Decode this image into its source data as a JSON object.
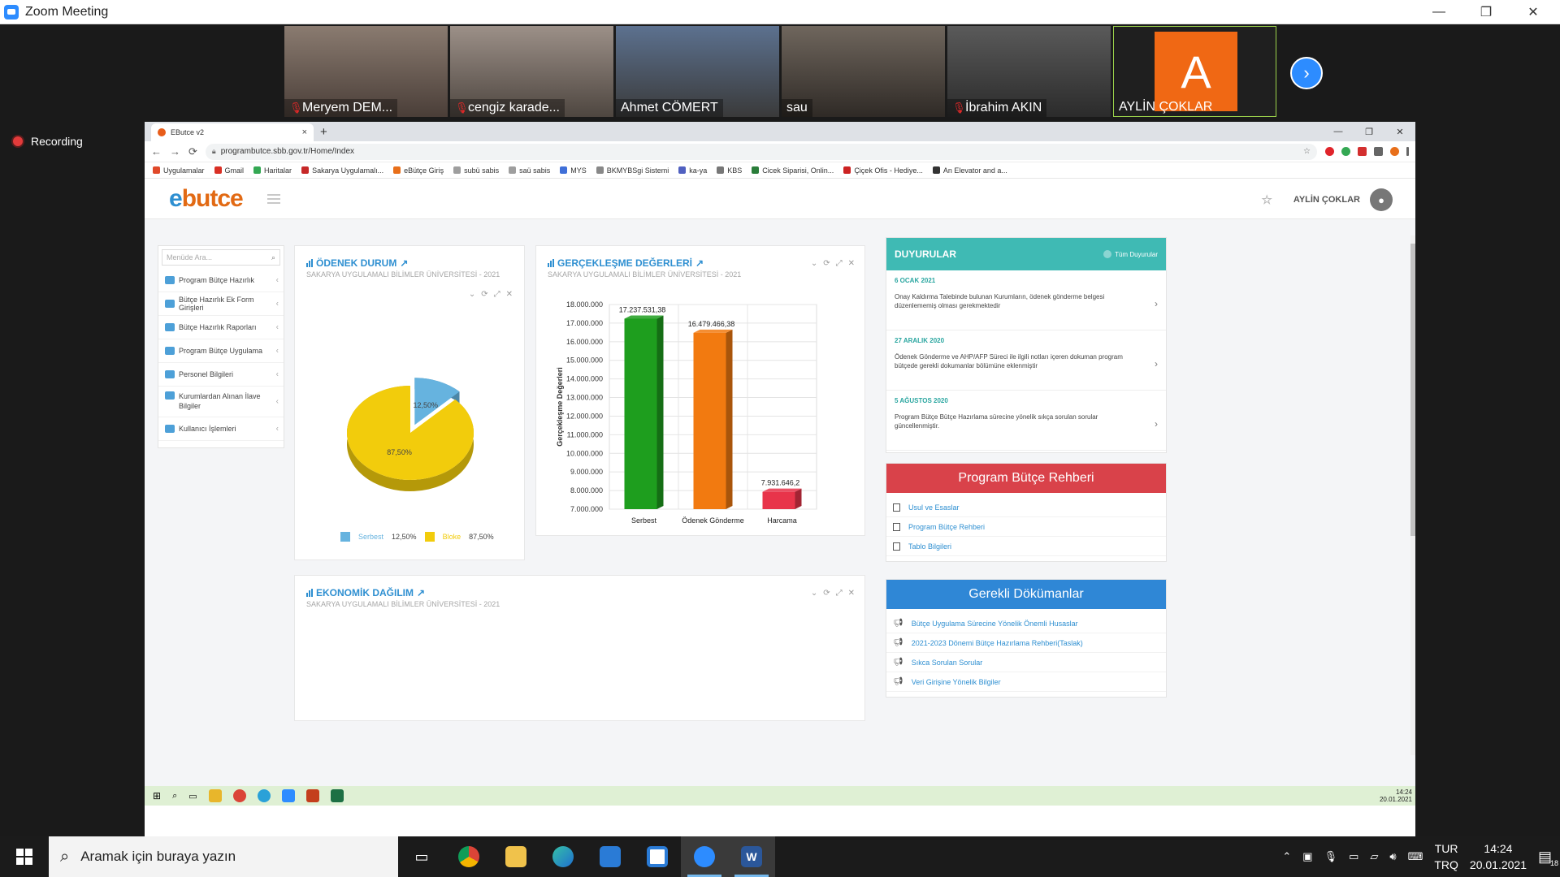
{
  "window": {
    "title": "Zoom Meeting",
    "minimize": "—",
    "restore": "❐",
    "close": "✕"
  },
  "participants": [
    {
      "name": "Meryem DEM...",
      "muted": true,
      "bg": "#6a5a52"
    },
    {
      "name": "cengiz karade...",
      "muted": true,
      "bg": "#7a7068"
    },
    {
      "name": "Ahmet CÖMERT",
      "muted": false,
      "bg": "#4c5f7a"
    },
    {
      "name": "sau",
      "muted": false,
      "bg": "#5a5148"
    },
    {
      "name": "İbrahim AKIN",
      "muted": true,
      "bg": "#4a4a4a"
    }
  ],
  "avatar_tile": {
    "letter": "A",
    "name": "AYLİN ÇOKLAR"
  },
  "next_icon": "›",
  "recording": {
    "label": "Recording"
  },
  "browser": {
    "tab_title": "EButce v2",
    "tab_close": "×",
    "new_tab": "+",
    "url": "programbutce.sbb.gov.tr/Home/Index",
    "nav": {
      "back": "←",
      "forward": "→",
      "reload": "⟳"
    },
    "win": {
      "min": "—",
      "max": "❐",
      "close": "✕"
    },
    "bookmarks": [
      {
        "label": "Uygulamalar",
        "color": "#e0492a"
      },
      {
        "label": "Gmail",
        "color": "#d93025"
      },
      {
        "label": "Haritalar",
        "color": "#34a853"
      },
      {
        "label": "Sakarya Uygulamalı...",
        "color": "#c62828"
      },
      {
        "label": "eBütçe Giriş",
        "color": "#e86f1a"
      },
      {
        "label": "subü sabis",
        "color": "#9e9e9e"
      },
      {
        "label": "saü sabis",
        "color": "#9e9e9e"
      },
      {
        "label": "MYS",
        "color": "#3f6fd8"
      },
      {
        "label": "BKMYBSgi Sistemi",
        "color": "#888888"
      },
      {
        "label": "ka-ya",
        "color": "#5060c0"
      },
      {
        "label": "KBS",
        "color": "#777777"
      },
      {
        "label": "Cicek Siparisi, Onlin...",
        "color": "#2a7d3a"
      },
      {
        "label": "Çiçek Ofis - Hediye...",
        "color": "#cc2222"
      },
      {
        "label": "An Elevator and a...",
        "color": "#333333"
      }
    ]
  },
  "app": {
    "brand_e": "e",
    "brand_rest": "butce",
    "user_name": "AYLİN ÇOKLAR",
    "search_placeholder": "Menüde Ara...",
    "menu": [
      "Program Bütçe Hazırlık",
      "Bütçe Hazırlık Ek Form Girişleri",
      "Bütçe Hazırlık Raporları",
      "Program Bütçe Uygulama",
      "Personel Bilgileri",
      "Kurumlardan Alınan İlave Bilgiler",
      "Kullanıcı İşlemleri"
    ]
  },
  "panel_odenek": {
    "title": "ÖDENEK DURUM",
    "subtitle": "SAKARYA UYGULAMALI BİLİMLER ÜNİVERSİTESİ - 2021"
  },
  "panel_gerceklesme": {
    "title": "GERÇEKLEŞME DEĞERLERİ",
    "subtitle": "SAKARYA UYGULAMALI BİLİMLER ÜNİVERSİTESİ - 2021"
  },
  "panel_ekonomik": {
    "title": "EKONOMİK DAĞILIM",
    "subtitle": "SAKARYA UYGULAMALI BİLİMLER ÜNİVERSİTESİ - 2021"
  },
  "chart_data": [
    {
      "type": "pie",
      "categories": [
        "Serbest",
        "Bloke"
      ],
      "values": [
        12.5,
        87.5
      ],
      "labels": [
        "12,50%",
        "87,50%"
      ],
      "legend_values": [
        "12,50%",
        "87,50%"
      ],
      "colors": [
        "#66b3df",
        "#f2cc0c"
      ],
      "legend": "bottom"
    },
    {
      "type": "bar",
      "categories": [
        "Serbest",
        "Ödenek Gönderme",
        "Harcama"
      ],
      "values": [
        17237531.38,
        16479466.38,
        7931646.2
      ],
      "value_labels": [
        "17.237.531,38",
        "16.479.466,38",
        "7.931.646,2"
      ],
      "colors": [
        "#1e9e1e",
        "#f27a10",
        "#e8344a"
      ],
      "ylabel": "Gerçekleşme Değerleri",
      "ylim": [
        7000000,
        18000000
      ],
      "yticks": [
        "18.000.000",
        "17.000.000",
        "16.000.000",
        "15.000.000",
        "14.000.000",
        "13.000.000",
        "12.000.000",
        "11.000.000",
        "10.000.000",
        "9.000.000",
        "8.000.000",
        "7.000.000"
      ],
      "grid": true
    }
  ],
  "announcements": {
    "title": "DUYURULAR",
    "all_label": "Tüm Duyurular",
    "items": [
      {
        "date": "6 OCAK 2021",
        "text": "Onay Kaldırma Talebinde bulunan Kurumların, ödenek gönderme belgesi düzenlememiş olması gerekmektedir"
      },
      {
        "date": "27 ARALIK 2020",
        "text": "Ödenek Gönderme ve AHP/AFP Süreci ile ilgili notları içeren dokuman program bütçede gerekli dokumanlar bölümüne eklenmiştir"
      },
      {
        "date": "5 AĞUSTOS 2020",
        "text": "Program Bütçe Bütçe Hazırlama sürecine yönelik sıkça sorulan sorular güncellenmiştir."
      }
    ]
  },
  "guide": {
    "title": "Program Bütçe Rehberi",
    "color": "#d9424a",
    "links": [
      "Usul ve Esaslar",
      "Program Bütçe Rehberi",
      "Tablo Bilgileri"
    ]
  },
  "docs": {
    "title": "Gerekli Dökümanlar",
    "color": "#2f87d6",
    "links": [
      "Bütçe Uygulama Sürecine Yönelik Önemli Husaslar",
      "2021-2023 Dönemi Bütçe Hazırlama Rehberi(Taslak)",
      "Sıkca Sorulan Sorular",
      "Veri Girişine Yönelik Bilgiler"
    ]
  },
  "inner_clock": {
    "time": "14:24",
    "date": "20.01.2021"
  },
  "taskbar": {
    "search_placeholder": "Aramak için buraya yazın",
    "lang_top": "TUR",
    "lang_bottom": "TRQ",
    "time": "14:24",
    "date": "20.01.2021",
    "notif_count": "18"
  }
}
